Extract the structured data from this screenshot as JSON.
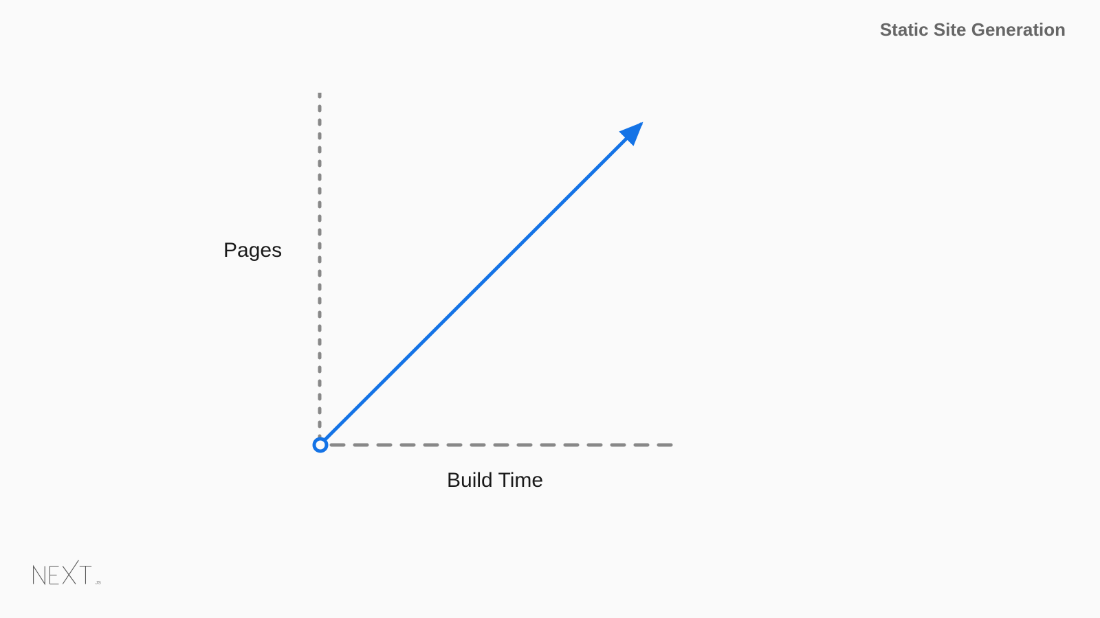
{
  "header": {
    "title": "Static Site Generation"
  },
  "chart_data": {
    "type": "line",
    "title": "Static Site Generation",
    "xlabel": "Build Time",
    "ylabel": "Pages",
    "description": "Conceptual linear relationship: as pages increase, build time increases proportionally",
    "series": [
      {
        "name": "build-time-vs-pages",
        "x": [
          0,
          1
        ],
        "values": [
          0,
          1
        ]
      }
    ],
    "xlim": [
      0,
      1
    ],
    "ylim": [
      0,
      1
    ],
    "axis_style": "dashed",
    "line_color": "#1473e6",
    "origin_marker": true
  },
  "logo": {
    "text": "NEXT",
    "suffix": ".JS"
  }
}
